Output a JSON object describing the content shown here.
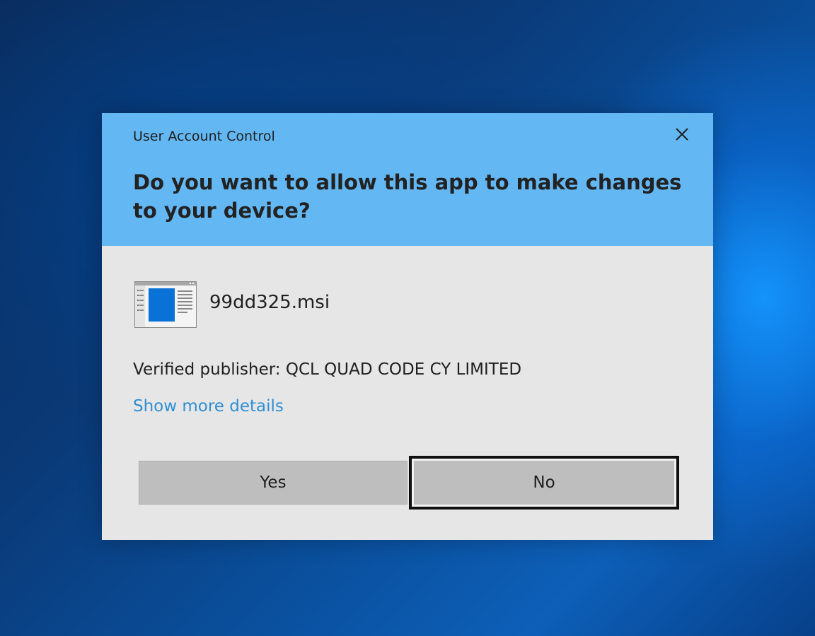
{
  "dialog": {
    "title": "User Account Control",
    "question": "Do you want to allow this app to make changes to your device?",
    "close_icon": "close-icon",
    "app_icon": "msi-installer-icon",
    "file_name": "99dd325.msi",
    "publisher": "Verified publisher: QCL QUAD CODE CY LIMITED",
    "details_link": "Show more details",
    "yes_label": "Yes",
    "no_label": "No"
  },
  "colors": {
    "header": "#63b7f3",
    "body": "#e6e6e6",
    "link": "#2f8fd4",
    "button": "#bebebe"
  }
}
